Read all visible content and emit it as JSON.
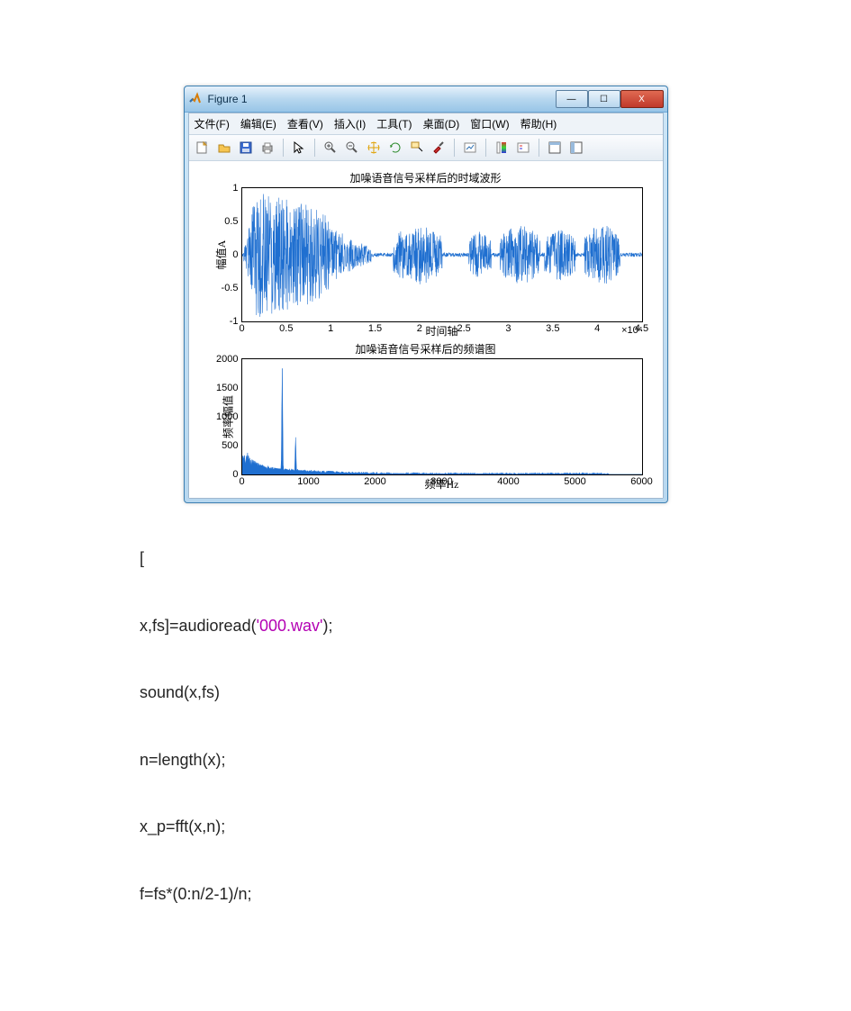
{
  "window": {
    "title": "Figure 1",
    "buttons": {
      "min": "—",
      "max": "☐",
      "close": "X"
    }
  },
  "menu": {
    "file": {
      "label": "文件",
      "accel": "(F)"
    },
    "edit": {
      "label": "编辑",
      "accel": "(E)"
    },
    "view": {
      "label": "查看",
      "accel": "(V)"
    },
    "insert": {
      "label": "插入",
      "accel": "(I)"
    },
    "tools": {
      "label": "工具",
      "accel": "(T)"
    },
    "desktop": {
      "label": "桌面",
      "accel": "(D)"
    },
    "window": {
      "label": "窗口",
      "accel": "(W)"
    },
    "help": {
      "label": "帮助",
      "accel": "(H)"
    }
  },
  "toolbar_icons": [
    "new-figure-icon",
    "open-icon",
    "save-icon",
    "print-icon",
    "sep",
    "pointer-icon",
    "sep",
    "zoom-in-icon",
    "zoom-out-icon",
    "pan-icon",
    "rotate-icon",
    "data-cursor-icon",
    "brush-icon",
    "sep",
    "link-icon",
    "sep",
    "colorbar-icon",
    "legend-icon",
    "sep",
    "layout-icon",
    "layout2-icon"
  ],
  "chart_data": [
    {
      "type": "line",
      "title": "加噪语音信号采样后的时域波形",
      "xlabel": "时间轴",
      "ylabel": "幅值A",
      "x_exp": "×10⁴",
      "xlim": [
        0,
        4.5
      ],
      "ylim": [
        -1,
        1
      ],
      "xticks": [
        0,
        0.5,
        1,
        1.5,
        2,
        2.5,
        3,
        3.5,
        4,
        4.5
      ],
      "yticks": [
        -1,
        -0.5,
        0,
        0.5,
        1
      ],
      "description": "dense noisy speech waveform; large burst 0–1, decaying by ~1.4, bursts around 1.7–2.2, 2.6–3.3, 3.4–4.2; baseline ≈0"
    },
    {
      "type": "line",
      "title": "加噪语音信号采样后的频谱图",
      "xlabel": "频率Hz",
      "ylabel": "频率幅值",
      "xlim": [
        0,
        6000
      ],
      "ylim": [
        0,
        2000
      ],
      "xticks": [
        0,
        1000,
        2000,
        3000,
        4000,
        5000,
        6000
      ],
      "yticks": [
        0,
        500,
        1000,
        1500,
        2000
      ],
      "peaks": [
        {
          "f": 600,
          "mag": 1850
        },
        {
          "f": 800,
          "mag": 650
        }
      ],
      "baseline_upto": 5500
    }
  ],
  "code": {
    "l1a": "[",
    "l2a": "x,fs]=audioread(",
    "l2b": "'000.wav'",
    "l2c": ");",
    "l3": "sound(x,fs)",
    "l4": "n=length(x);",
    "l5": "x_p=fft(x,n);",
    "l6": "f=fs*(0:n/2-1)/n;"
  }
}
